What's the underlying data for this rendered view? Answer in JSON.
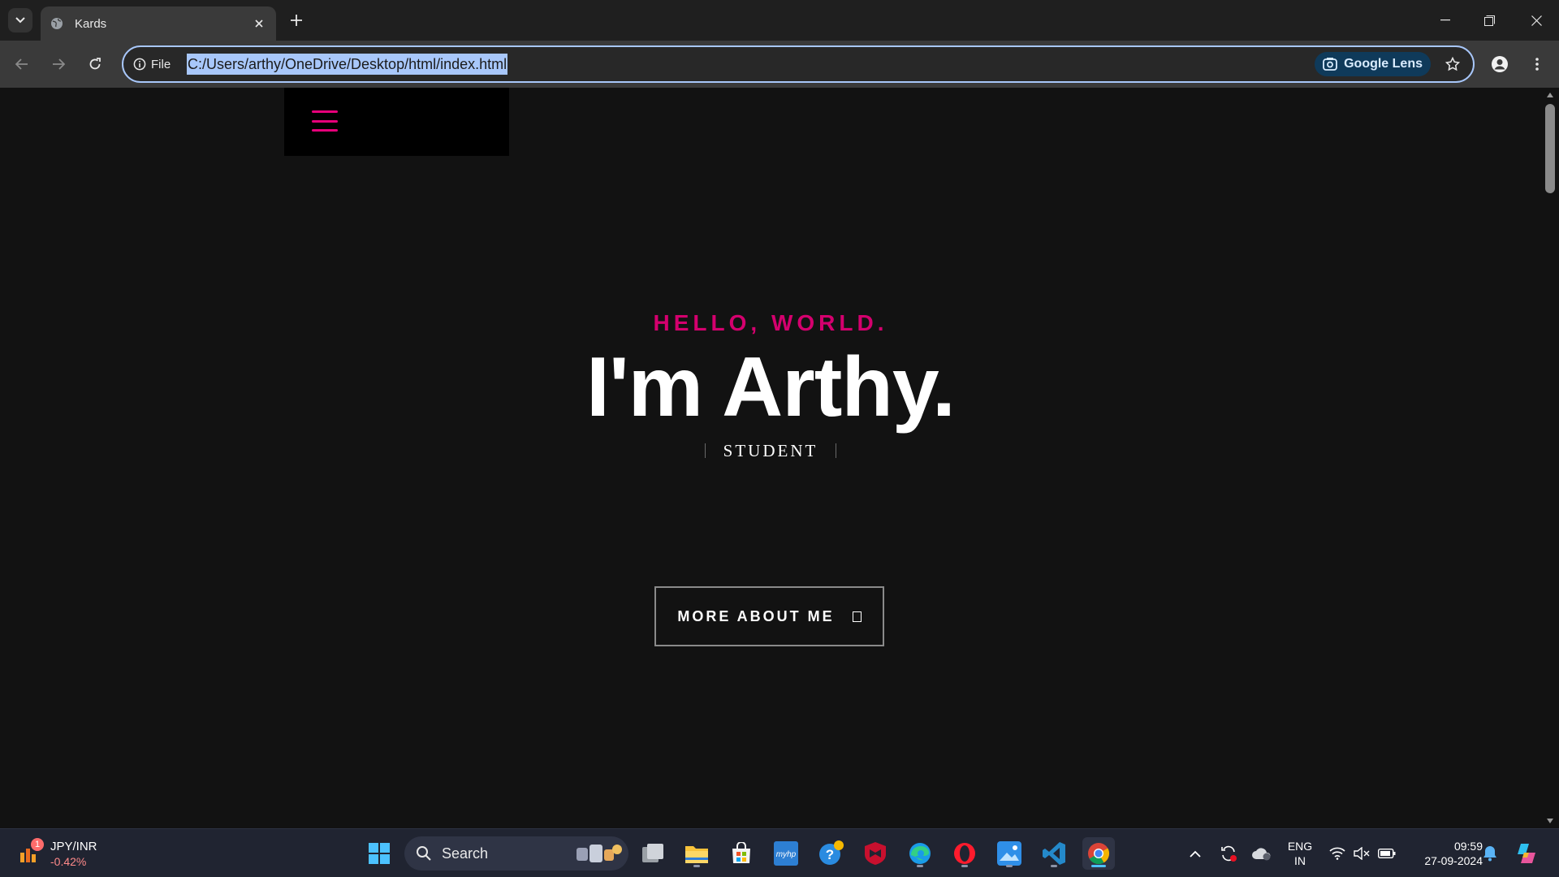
{
  "browser": {
    "tab_title": "Kards",
    "site_info_label": "File",
    "url": "C:/Users/arthy/OneDrive/Desktop/html/index.html",
    "lens_label": "Google Lens"
  },
  "page": {
    "greeting": "HELLO, WORLD.",
    "name": "I'm Arthy.",
    "role": "STUDENT",
    "cta_label": "MORE ABOUT ME",
    "accent_color": "#e6007a"
  },
  "taskbar": {
    "widget": {
      "pair": "JPY/INR",
      "change": "-0.42%",
      "badge": "1"
    },
    "search_label": "Search",
    "language": [
      "ENG",
      "IN"
    ],
    "time": "09:59",
    "date": "27-09-2024"
  }
}
